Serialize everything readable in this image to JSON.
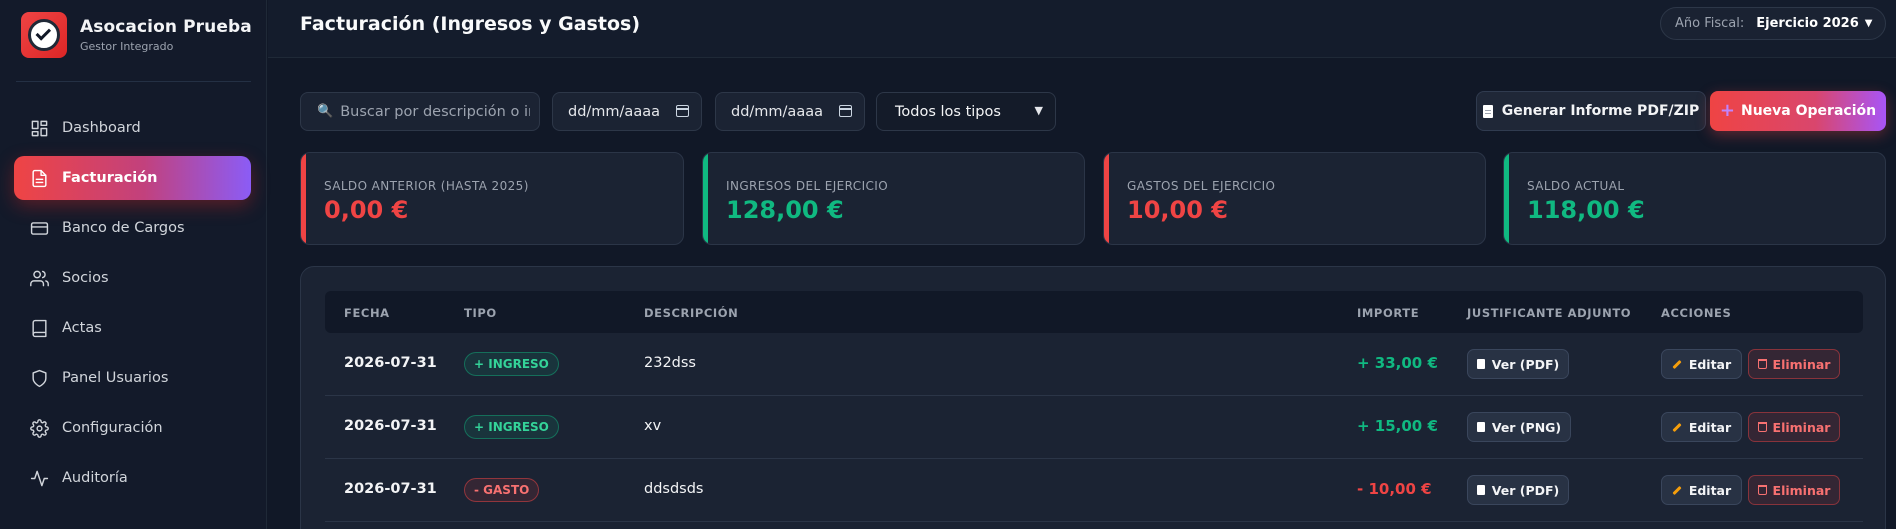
{
  "app": {
    "name": "Asocacion Prueba",
    "subtitle": "Gestor Integrado"
  },
  "sidebar": {
    "items": [
      {
        "label": "Dashboard",
        "icon": "dashboard-icon",
        "active": false
      },
      {
        "label": "Facturación",
        "icon": "invoice-icon",
        "active": true
      },
      {
        "label": "Banco de Cargos",
        "icon": "card-icon",
        "active": false
      },
      {
        "label": "Socios",
        "icon": "users-icon",
        "active": false
      },
      {
        "label": "Actas",
        "icon": "book-icon",
        "active": false
      },
      {
        "label": "Panel Usuarios",
        "icon": "shield-icon",
        "active": false
      },
      {
        "label": "Configuración",
        "icon": "gear-icon",
        "active": false
      },
      {
        "label": "Auditoría",
        "icon": "activity-icon",
        "active": false
      }
    ]
  },
  "header": {
    "title": "Facturación (Ingresos y Gastos)",
    "fiscal_label": "Año Fiscal:",
    "fiscal_value": "Ejercicio 2026"
  },
  "filters": {
    "search_placeholder": "Buscar por descripción o importe...",
    "date_from_placeholder": "dd/mm/aaaa",
    "date_to_placeholder": "dd/mm/aaaa",
    "type_selected": "Todos los tipos"
  },
  "actions": {
    "report_label": "Generar Informe PDF/ZIP",
    "new_label": "Nueva Operación"
  },
  "summary": [
    {
      "label": "SALDO ANTERIOR (HASTA 2025)",
      "value": "0,00 €",
      "color": "#ef4444"
    },
    {
      "label": "INGRESOS DEL EJERCICIO",
      "value": "128,00 €",
      "color": "#10b981"
    },
    {
      "label": "GASTOS DEL EJERCICIO",
      "value": "10,00 €",
      "color": "#ef4444"
    },
    {
      "label": "SALDO ACTUAL",
      "value": "118,00 €",
      "color": "#10b981"
    }
  ],
  "table": {
    "headers": [
      "FECHA",
      "TIPO",
      "DESCRIPCIÓN",
      "IMPORTE",
      "JUSTIFICANTE ADJUNTO",
      "ACCIONES"
    ],
    "edit_label": "Editar",
    "delete_label": "Eliminar",
    "rows": [
      {
        "date": "2026-07-31",
        "type": "+ INGRESO",
        "kind": "in",
        "description": "232dss",
        "amount": "+ 33,00 €",
        "attachment": "Ver (PDF)"
      },
      {
        "date": "2026-07-31",
        "type": "+ INGRESO",
        "kind": "in",
        "description": "xv",
        "amount": "+ 15,00 €",
        "attachment": "Ver (PNG)"
      },
      {
        "date": "2026-07-31",
        "type": "- GASTO",
        "kind": "out",
        "description": "ddsdsds",
        "amount": "- 10,00 €",
        "attachment": "Ver (PDF)"
      }
    ]
  },
  "colors": {
    "income": "#10b981",
    "expense": "#ef4444",
    "accent_gradient_start": "#ef4444",
    "accent_gradient_end": "#8b5cf6"
  }
}
